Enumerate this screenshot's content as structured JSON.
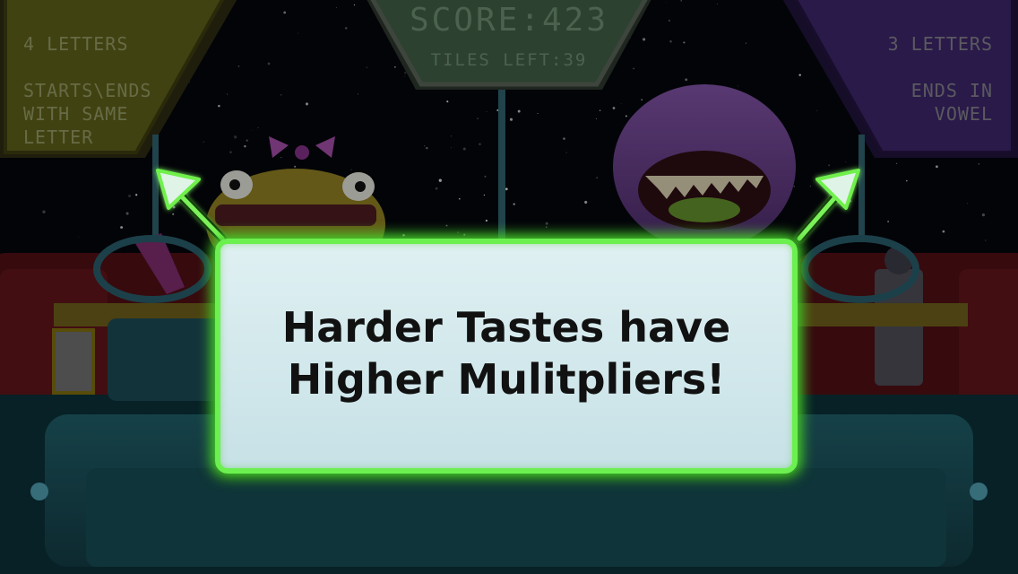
{
  "hud": {
    "left_panel": {
      "title": "4 LETTERS",
      "subtitle": "STARTS\\ENDS\nWITH SAME\nLETTER"
    },
    "right_panel": {
      "title": "3 LETTERS",
      "subtitle": "ENDS IN\nVOWEL"
    },
    "score": "SCORE:423",
    "tiles_left": "TILES LEFT:39"
  },
  "tutorial": {
    "line1": "Harder Tastes have",
    "line2": "Higher Mulitpliers!"
  },
  "colors": {
    "callout_border": "#6cf050",
    "callout_fill": "#dff0f2",
    "left_panel": "#6b6b1a",
    "right_panel": "#3f2470",
    "hud_center": "#4a6b4a"
  },
  "icons": {
    "left_arrow": "arrow-up-left-icon",
    "right_arrow": "arrow-up-right-icon"
  }
}
